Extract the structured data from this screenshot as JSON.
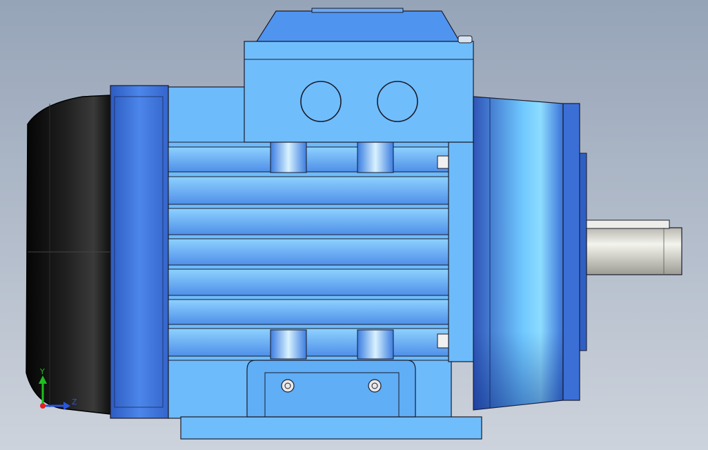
{
  "viewport": {
    "colors": {
      "background_top": "#96a4b8",
      "background_bottom": "#cdd3dc",
      "motor_blue": "#6fbdfb",
      "motor_blue_light": "#8dd3ff",
      "motor_blue_dark": "#3a6fd8",
      "end_cap_dark": "#3464c4",
      "fan_cover": "#151515",
      "shaft": "#dcdcd4",
      "edge": "#1a1a2a"
    },
    "triad": {
      "y_label": "Y",
      "z_label": "Z",
      "y_color": "#1fbf1f",
      "z_color": "#2a55e0",
      "x_color": "#e02020"
    }
  }
}
